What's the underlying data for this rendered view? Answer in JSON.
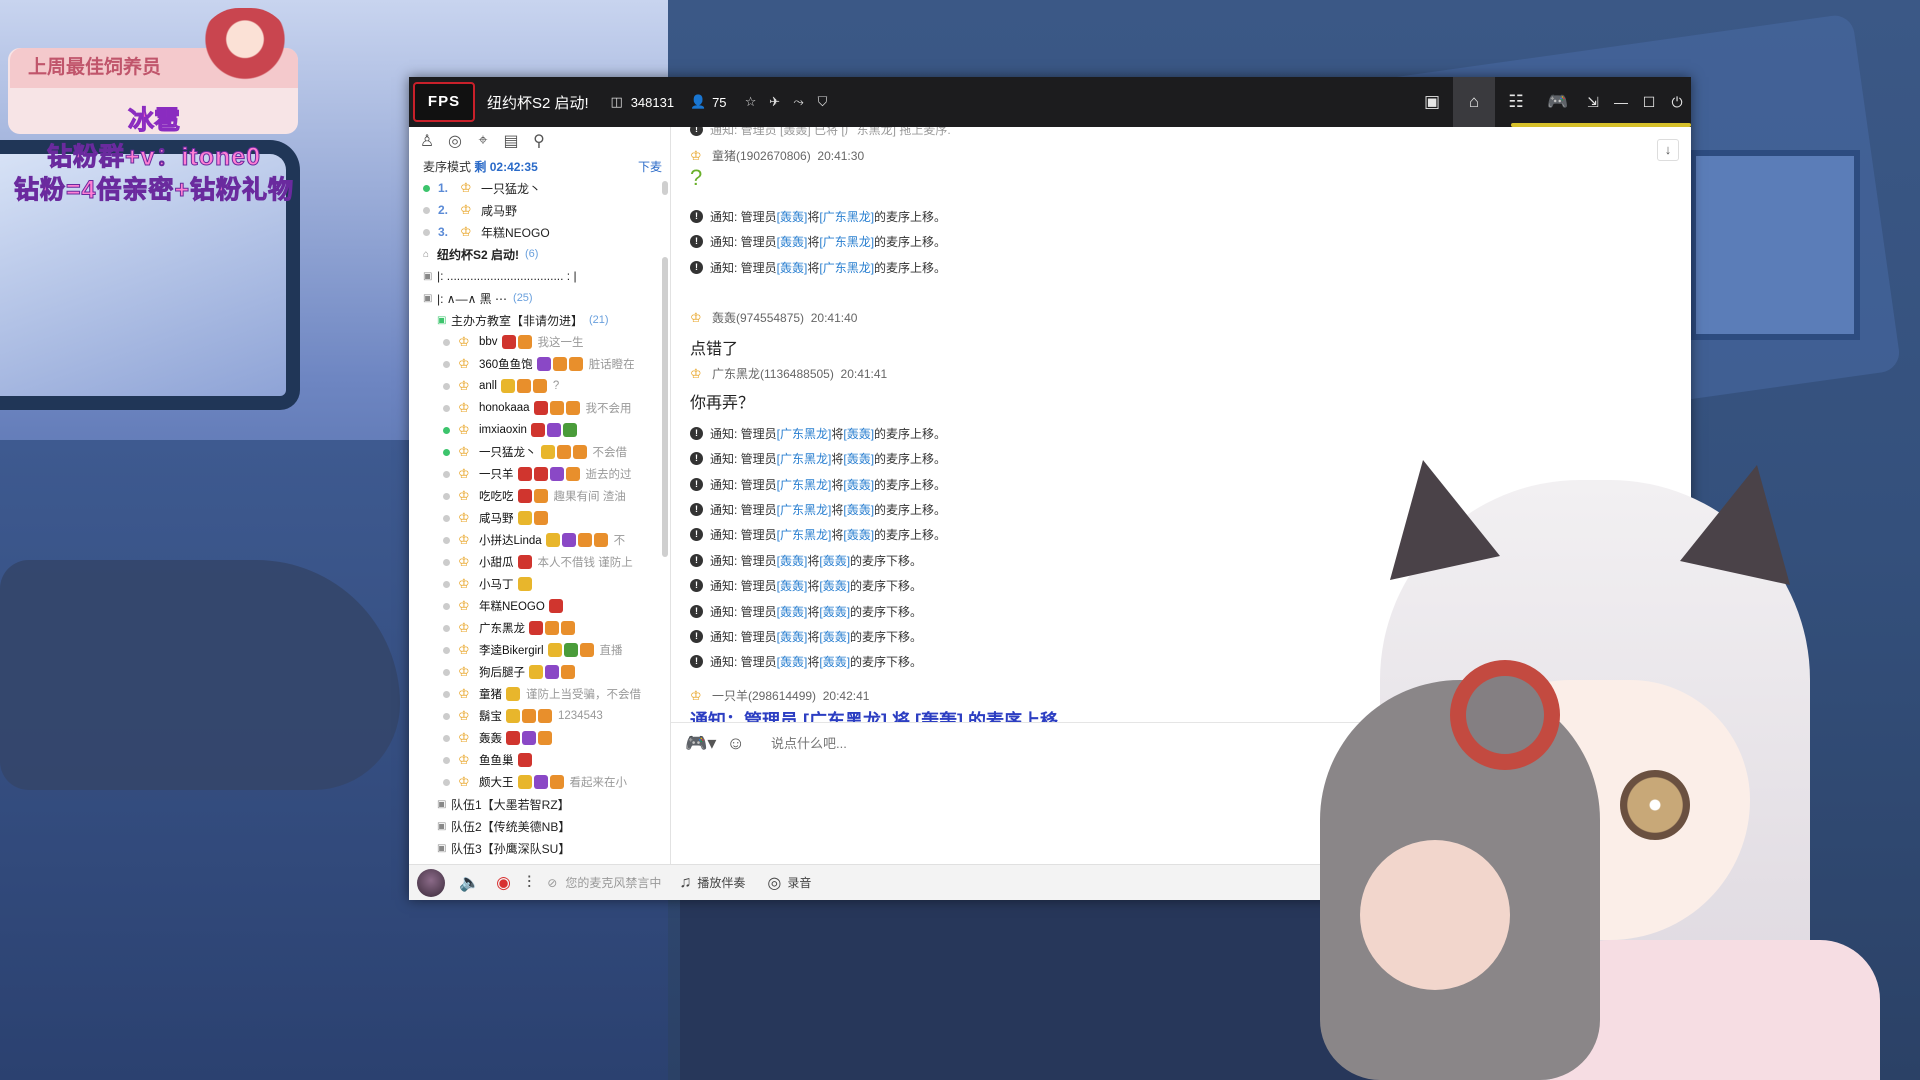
{
  "overlay": {
    "badge_title": "上周最佳饲养员",
    "badge_name": "冰雹",
    "promo_line1": "钻粉群+v：itone0",
    "promo_line2": "钻粉=4倍亲密+钻粉礼物"
  },
  "titlebar": {
    "logo_text": "FPS",
    "room_title": "纽约杯S2 启动!",
    "room_id": "348131",
    "online_count": "75"
  },
  "queue": {
    "mode_label": "麦序模式",
    "remaining_prefix": "剩",
    "time": "02:42:35",
    "down_label": "下麦",
    "items": [
      {
        "num": "1.",
        "name": "一只猛龙丶"
      },
      {
        "num": "2.",
        "name": "咸马野"
      },
      {
        "num": "3.",
        "name": "年糕NEOGO"
      }
    ]
  },
  "channels": {
    "main": {
      "name": "纽约杯S2 启动!",
      "count": "(6)"
    },
    "sub1": {
      "name": "|: ...................................  : |"
    },
    "sub2": {
      "name": "|:          ∧—∧     黑       ⋯",
      "count": "(25)"
    },
    "host": {
      "name": "主办方教室【非请勿进】",
      "count": "(21)"
    },
    "teams": [
      "队伍1【大墨若智RZ】",
      "队伍2【传统美德NB】",
      "队伍3【孙鹰深队SU】"
    ]
  },
  "members": [
    {
      "name": "bbv",
      "sig": "我这一生"
    },
    {
      "name": "360鱼鱼饱",
      "sig": "脏话瞪在"
    },
    {
      "name": "anll",
      "sig": "?"
    },
    {
      "name": "honokaaa",
      "sig": "我不会用"
    },
    {
      "name": "imxiaoxin",
      "sig": ""
    },
    {
      "name": "一只猛龙丶",
      "sig": "不会借"
    },
    {
      "name": "一只羊",
      "sig": "逝去的过"
    },
    {
      "name": "吃吃吃",
      "sig": "趣果有间 渣油"
    },
    {
      "name": "咸马野",
      "sig": ""
    },
    {
      "name": "小拼达Linda",
      "sig": "不"
    },
    {
      "name": "小甜瓜",
      "sig": "本人不借钱 谨防上"
    },
    {
      "name": "小马丁",
      "sig": ""
    },
    {
      "name": "年糕NEOGO",
      "sig": ""
    },
    {
      "name": "广东黑龙",
      "sig": ""
    },
    {
      "name": "李逵Bikergirl",
      "sig": "直播"
    },
    {
      "name": "狗后腿子",
      "sig": ""
    },
    {
      "name": "童猪",
      "sig": "谨防上当受骗，不会借"
    },
    {
      "name": "鬍宝",
      "sig": "1234543"
    },
    {
      "name": "轰轰",
      "sig": ""
    },
    {
      "name": "鱼鱼巢",
      "sig": ""
    },
    {
      "name": "颇大王",
      "sig": "看起来在小"
    }
  ],
  "chat": {
    "top_partial": "通知: 管理员 [轰轰] 已将 [广东黑龙] 拖上麦序.",
    "notice_prefix": "通知: 管理员",
    "jiang": "将",
    "up_suffix": "的麦序上移。",
    "down_suffix": "的麦序下移。",
    "u1_header": "童猪(1902670806)",
    "u1_time": "20:41:30",
    "u1_msg": "?",
    "g1": [
      {
        "admin": "[轰轰]",
        "target": "[广东黑龙]"
      },
      {
        "admin": "[轰轰]",
        "target": "[广东黑龙]"
      },
      {
        "admin": "[轰轰]",
        "target": "[广东黑龙]"
      }
    ],
    "u2_header": "轰轰(974554875)",
    "u2_time": "20:41:40",
    "u2_msg": "点错了",
    "u3_header": "广东黑龙(1136488505)",
    "u3_time": "20:41:41",
    "u3_msg": "你再弄？",
    "g2": [
      {
        "admin": "[广东黑龙]",
        "target": "[轰轰]"
      },
      {
        "admin": "[广东黑龙]",
        "target": "[轰轰]"
      },
      {
        "admin": "[广东黑龙]",
        "target": "[轰轰]"
      },
      {
        "admin": "[广东黑龙]",
        "target": "[轰轰]"
      },
      {
        "admin": "[广东黑龙]",
        "target": "[轰轰]"
      }
    ],
    "g3": [
      {
        "admin": "[轰轰]",
        "target": "[轰轰]"
      },
      {
        "admin": "[轰轰]",
        "target": "[轰轰]"
      },
      {
        "admin": "[轰轰]",
        "target": "[轰轰]"
      },
      {
        "admin": "[轰轰]",
        "target": "[轰轰]"
      },
      {
        "admin": "[轰轰]",
        "target": "[轰轰]"
      }
    ],
    "u4_header": "一只羊(298614499)",
    "u4_time": "20:42:41",
    "big_notice": "通知：管理员 [广东黑龙] 将 [轰轰] 的麦序上移。"
  },
  "input": {
    "placeholder": "说点什么吧..."
  },
  "bottombar": {
    "mic_status": "您的麦克风禁言中",
    "play_accompany": "播放伴奏",
    "record": "录音"
  },
  "colors": {
    "accent": "#2a6ac8",
    "notice_blue": "#2c3ec2",
    "titlebar": "#1c1c1e",
    "link": "#2a7fd0"
  }
}
